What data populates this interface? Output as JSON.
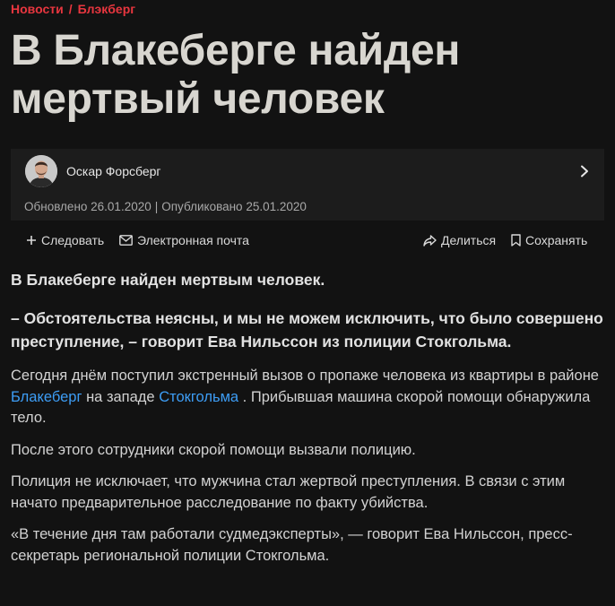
{
  "breadcrumb": {
    "items": [
      "Новости",
      "Блэкберг"
    ],
    "separator": "/"
  },
  "article": {
    "title": "В Блакеберге найден мертвый человек",
    "author": {
      "name": "Оскар Форсберг",
      "avatar": "author-avatar"
    },
    "dates": {
      "updated": "Обновлено 26.01.2020",
      "separator": "|",
      "published": "Опубликовано 25.01.2020"
    }
  },
  "actions": {
    "follow": "Следовать",
    "email": "Электронная почта",
    "share": "Делиться",
    "save": "Сохранять"
  },
  "body": {
    "lead1": "В Блакеберге найден мертвым человек.",
    "lead2": "– Обстоятельства неясны, и мы не можем исключить, что было совершено преступление, – говорит Ева Нильссон из полиции Стокгольма.",
    "p1": {
      "before": "Сегодня днём поступил экстренный вызов о пропаже человека из квартиры в районе ",
      "link1": "Блакеберг",
      "middle": " на западе ",
      "link2": "Стокгольма",
      "after": " . Прибывшая машина скорой помощи обнаружила тело."
    },
    "p2": "После этого сотрудники скорой помощи вызвали полицию.",
    "p3": "Полиция не исключает, что мужчина стал жертвой преступления. В связи с этим начато предварительное расследование по факту убийства.",
    "p4": "«В течение дня там работали судмедэксперты», — говорит Ева Нильссон, пресс-секретарь региональной полиции Стокгольма."
  },
  "colors": {
    "background": "#121212",
    "accent": "#e8363f",
    "link": "#3d9df5",
    "title": "#d8d6d0",
    "card": "#1c1c1c"
  }
}
